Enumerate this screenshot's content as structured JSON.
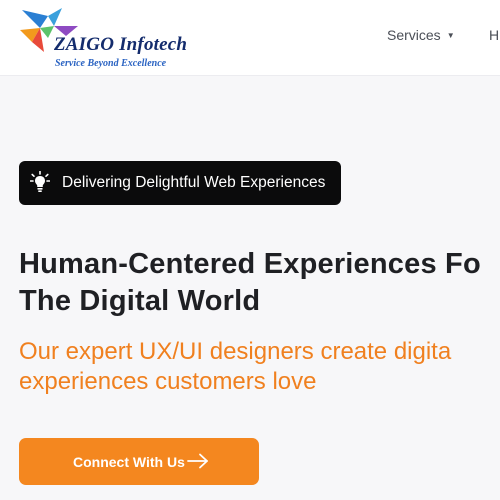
{
  "header": {
    "logo": {
      "name": "ZAIGO Infotech",
      "tagline": "Service Beyond Excellence"
    },
    "nav": {
      "services_label": "Services",
      "next_label_partial": "Hi"
    }
  },
  "hero": {
    "badge": {
      "icon": "lightbulb-icon",
      "text": "Delivering Delightful Web Experiences"
    },
    "headline": {
      "line1": "Human-Centered Experiences Fo",
      "line2": "The Digital World"
    },
    "subheadline": {
      "line1": "Our expert UX/UI designers create digita",
      "line2": "experiences customers love"
    },
    "cta": {
      "label": "Connect With Us",
      "icon": "arrow-right-icon"
    }
  },
  "colors": {
    "accent_orange": "#f4871f",
    "headline_text": "#1f2024",
    "badge_background": "#0b0b0c",
    "logo_navy": "#142c6d",
    "tagline_blue": "#2a63c2"
  }
}
